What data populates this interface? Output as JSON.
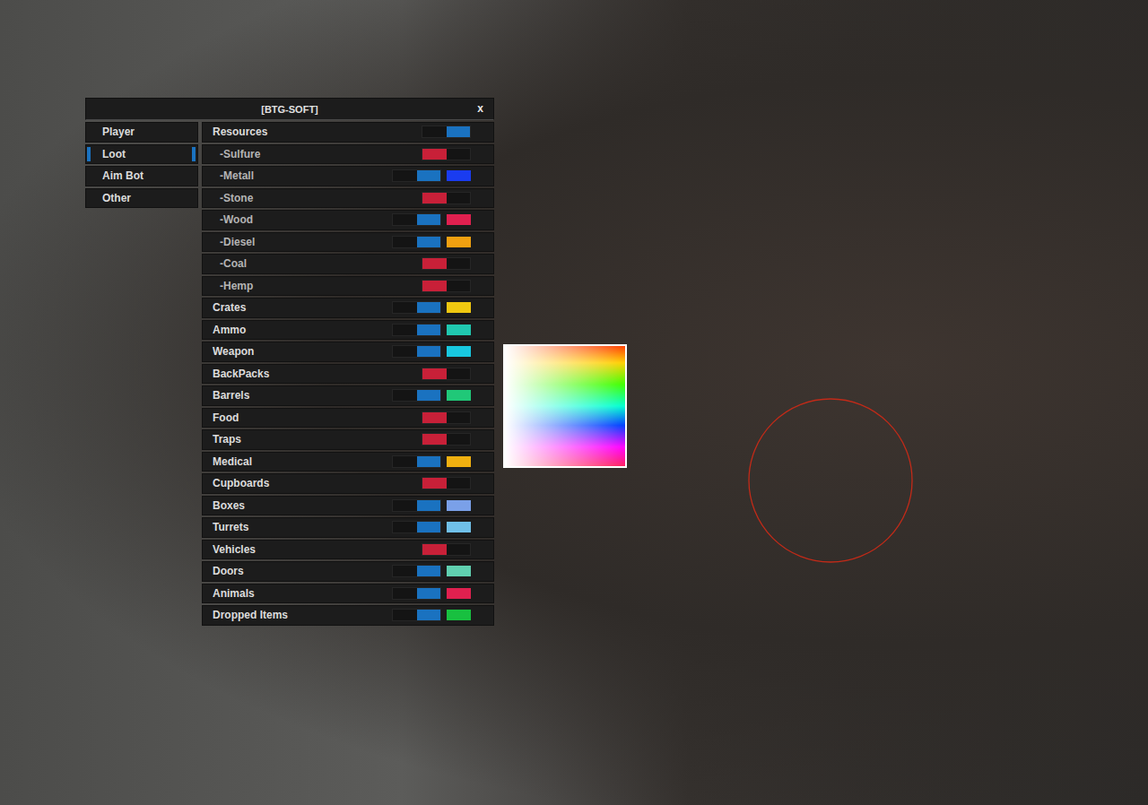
{
  "window": {
    "title": "[BTG-SOFT]",
    "close": "x"
  },
  "tabs": [
    {
      "label": "Player",
      "selected": false
    },
    {
      "label": "Loot",
      "selected": true
    },
    {
      "label": "Aim Bot",
      "selected": false
    },
    {
      "label": "Other",
      "selected": false
    }
  ],
  "items": [
    {
      "label": "Resources",
      "kind": "group",
      "on": true
    },
    {
      "label": "-Sulfure",
      "kind": "sub",
      "on": false
    },
    {
      "label": "-Metall",
      "kind": "sub",
      "on": true,
      "color": "#1a3cf0"
    },
    {
      "label": "-Stone",
      "kind": "sub",
      "on": false
    },
    {
      "label": "-Wood",
      "kind": "sub",
      "on": true,
      "color": "#e0204f"
    },
    {
      "label": "-Diesel",
      "kind": "sub",
      "on": true,
      "color": "#f0a010"
    },
    {
      "label": "-Coal",
      "kind": "sub",
      "on": false
    },
    {
      "label": "-Hemp",
      "kind": "sub",
      "on": false
    },
    {
      "label": "Crates",
      "kind": "group",
      "on": true,
      "color": "#f0c810"
    },
    {
      "label": "Ammo",
      "kind": "group",
      "on": true,
      "color": "#20c8b0"
    },
    {
      "label": "Weapon",
      "kind": "group",
      "on": true,
      "color": "#18c8e0"
    },
    {
      "label": "BackPacks",
      "kind": "group",
      "on": false
    },
    {
      "label": "Barrels",
      "kind": "group",
      "on": true,
      "color": "#20c878"
    },
    {
      "label": "Food",
      "kind": "group",
      "on": false
    },
    {
      "label": "Traps",
      "kind": "group",
      "on": false
    },
    {
      "label": "Medical",
      "kind": "group",
      "on": true,
      "color": "#f0b010"
    },
    {
      "label": "Cupboards",
      "kind": "group",
      "on": false
    },
    {
      "label": "Boxes",
      "kind": "group",
      "on": true,
      "color": "#7aa0e8"
    },
    {
      "label": "Turrets",
      "kind": "group",
      "on": true,
      "color": "#70c0e8"
    },
    {
      "label": "Vehicles",
      "kind": "group",
      "on": false
    },
    {
      "label": "Doors",
      "kind": "group",
      "on": true,
      "color": "#60d0b0"
    },
    {
      "label": "Animals",
      "kind": "group",
      "on": true,
      "color": "#e0204f"
    },
    {
      "label": "Dropped Items",
      "kind": "group",
      "on": true,
      "color": "#18c040"
    }
  ],
  "color_picker": {
    "open": true
  },
  "fov_circle": {
    "visible": true
  }
}
